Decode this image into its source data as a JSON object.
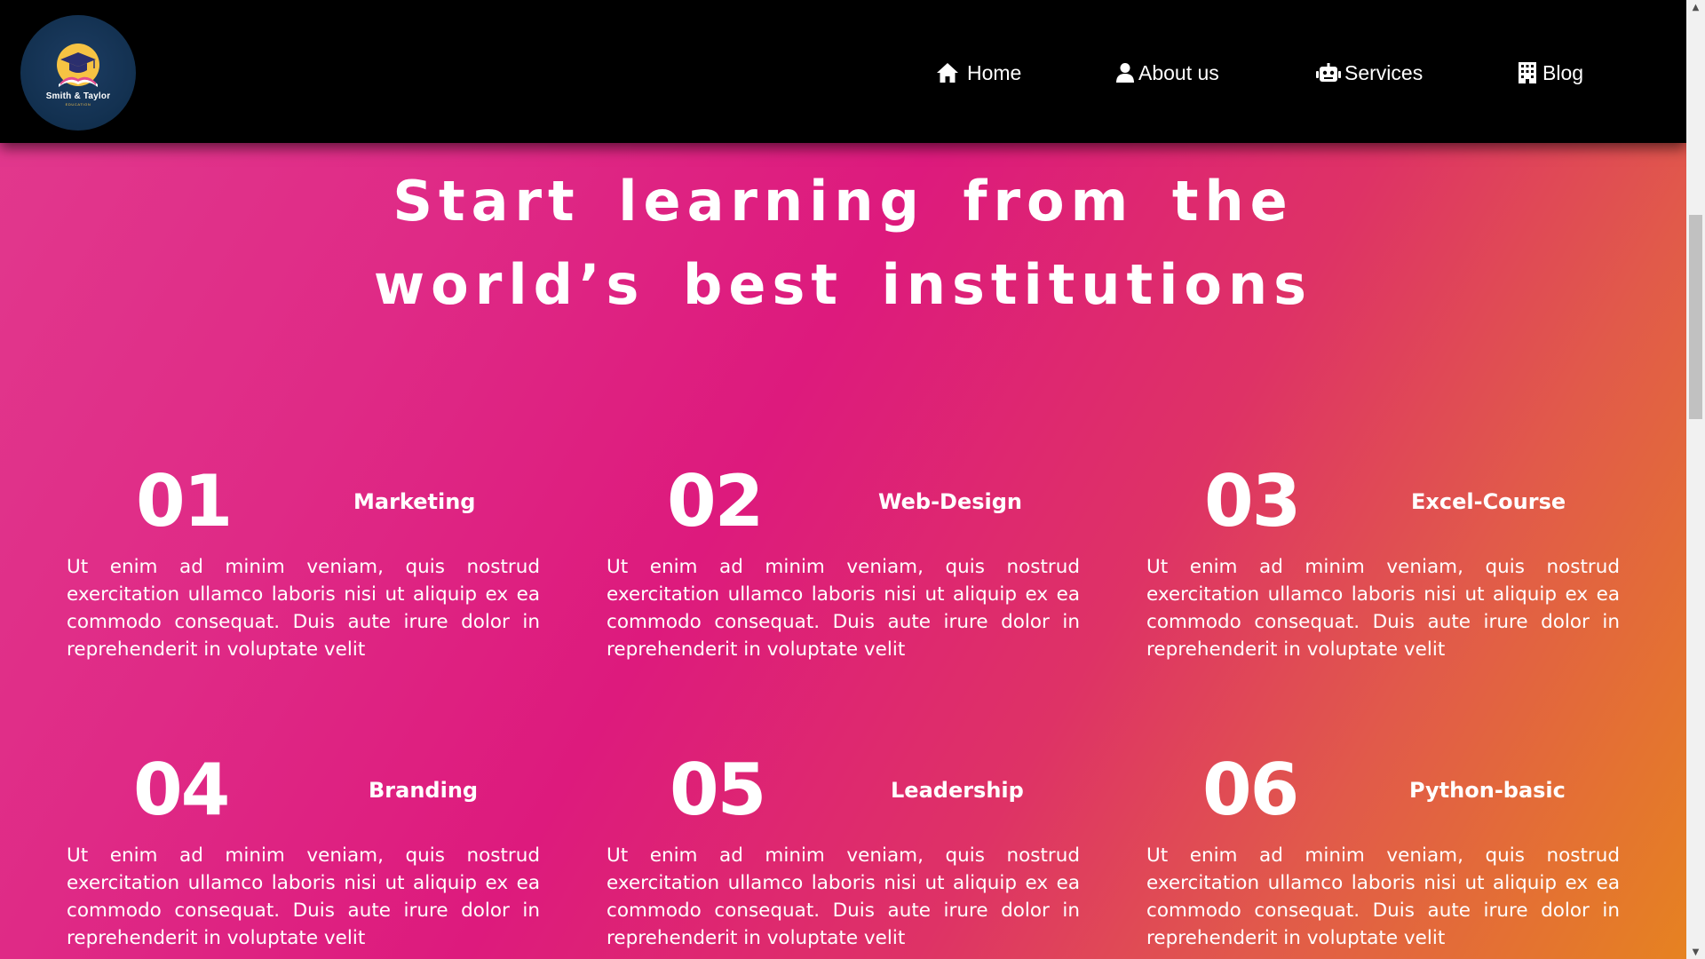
{
  "logo": {
    "name": "Smith & Taylor",
    "tagline": "EDUCATION"
  },
  "nav": [
    {
      "label": "Home",
      "icon": "home-icon"
    },
    {
      "label": "About us",
      "icon": "user-icon"
    },
    {
      "label": "Services",
      "icon": "robot-icon"
    },
    {
      "label": "Blog",
      "icon": "building-icon"
    }
  ],
  "hero": {
    "line1": "Start learning from the",
    "line2": "world’s best institutions"
  },
  "courses": [
    {
      "number": "01",
      "title": "Marketing",
      "description": "Ut enim ad minim veniam, quis nostrud exercitation ullamco laboris nisi ut aliquip ex ea commodo consequat. Duis aute irure dolor in reprehenderit in voluptate velit"
    },
    {
      "number": "02",
      "title": "Web-Design",
      "description": "Ut enim ad minim veniam, quis nostrud exercitation ullamco laboris nisi ut aliquip ex ea commodo consequat. Duis aute irure dolor in reprehenderit in voluptate velit"
    },
    {
      "number": "03",
      "title": "Excel-Course",
      "description": "Ut enim ad minim veniam, quis nostrud exercitation ullamco laboris nisi ut aliquip ex ea commodo consequat. Duis aute irure dolor in reprehenderit in voluptate velit"
    },
    {
      "number": "04",
      "title": "Branding",
      "description": "Ut enim ad minim veniam, quis nostrud exercitation ullamco laboris nisi ut aliquip ex ea commodo consequat. Duis aute irure dolor in reprehenderit in voluptate velit"
    },
    {
      "number": "05",
      "title": "Leadership",
      "description": "Ut enim ad minim veniam, quis nostrud exercitation ullamco laboris nisi ut aliquip ex ea commodo consequat. Duis aute irure dolor in reprehenderit in voluptate velit"
    },
    {
      "number": "06",
      "title": "Python-basic",
      "description": "Ut enim ad minim veniam, quis nostrud exercitation ullamco laboris nisi ut aliquip ex ea commodo consequat. Duis aute irure dolor in reprehenderit in voluptate velit"
    }
  ],
  "colors": {
    "header_bg": "#000000",
    "gradient_pink": "#dd1a7d",
    "gradient_orange": "#e6841f",
    "text": "#ffffff"
  }
}
